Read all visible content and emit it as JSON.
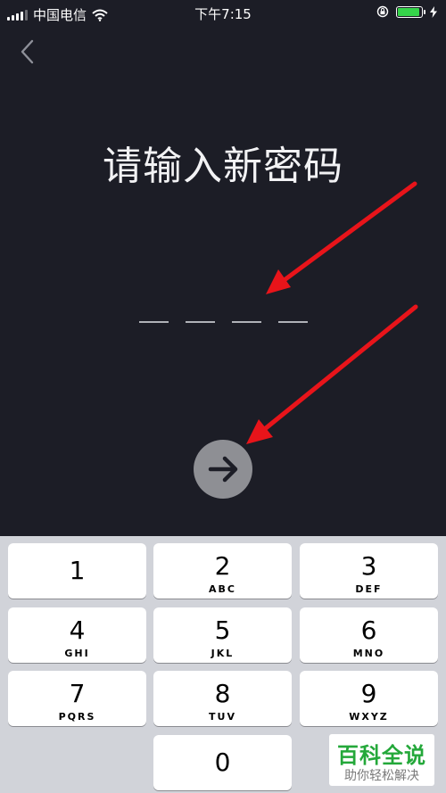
{
  "status_bar": {
    "carrier": "中国电信",
    "time": "下午7:15",
    "battery_color": "#35d44a"
  },
  "back_icon": "chevron-left-icon",
  "title": "请输入新密码",
  "pin": {
    "length": 4,
    "entered": 0
  },
  "next_icon": "arrow-right-icon",
  "annotation_color": "#e8141a",
  "keypad": {
    "keys": [
      {
        "digit": "1",
        "letters": ""
      },
      {
        "digit": "2",
        "letters": "ABC"
      },
      {
        "digit": "3",
        "letters": "DEF"
      },
      {
        "digit": "4",
        "letters": "GHI"
      },
      {
        "digit": "5",
        "letters": "JKL"
      },
      {
        "digit": "6",
        "letters": "MNO"
      },
      {
        "digit": "7",
        "letters": "PQRS"
      },
      {
        "digit": "8",
        "letters": "TUV"
      },
      {
        "digit": "9",
        "letters": "WXYZ"
      },
      {
        "digit": "0",
        "letters": ""
      }
    ]
  },
  "watermark": {
    "title": "百科全说",
    "subtitle": "助你轻松解决"
  }
}
